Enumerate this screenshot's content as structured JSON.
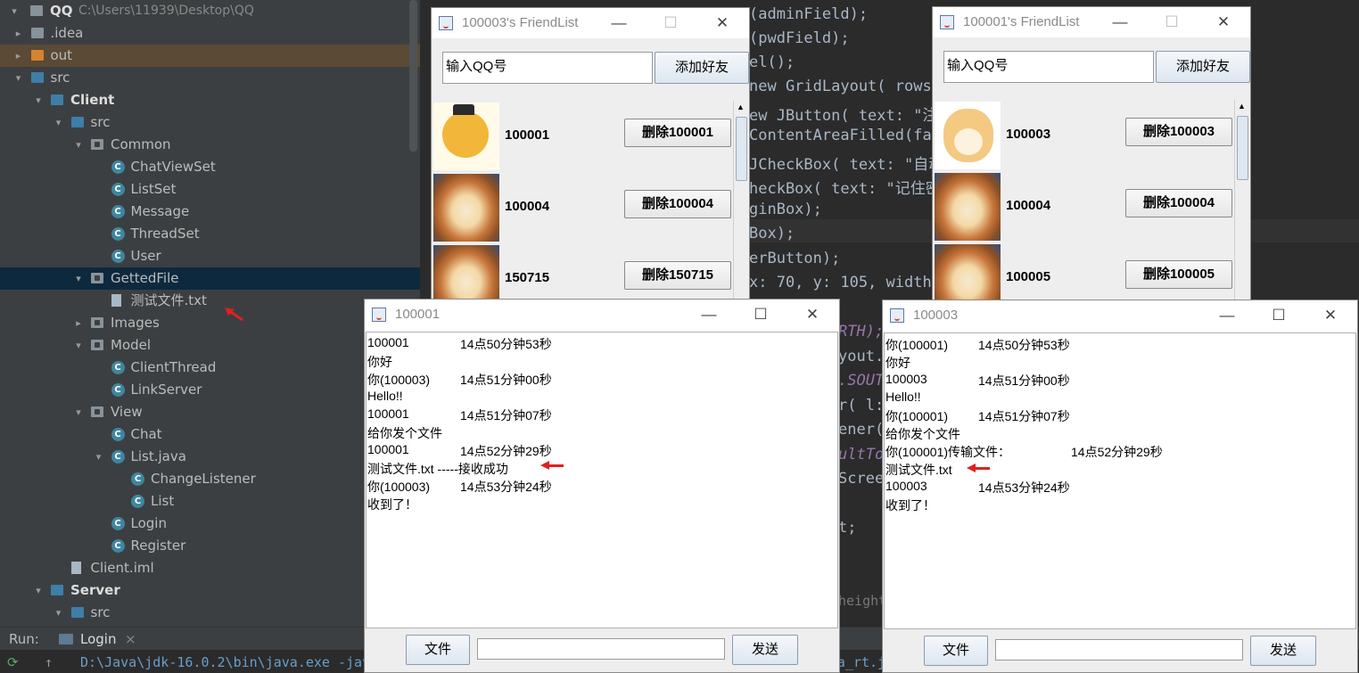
{
  "project_tree": {
    "root": {
      "name": "QQ",
      "path": "C:\\Users\\11939\\Desktop\\QQ"
    },
    "items": [
      {
        "label": ".idea",
        "kind": "folder",
        "depth": 1
      },
      {
        "label": "out",
        "kind": "folder-orange",
        "depth": 1
      },
      {
        "label": "src",
        "kind": "folder-blue",
        "depth": 1
      },
      {
        "label": "Client",
        "kind": "package-bold",
        "depth": 2
      },
      {
        "label": "src",
        "kind": "folder-blue",
        "depth": 3
      },
      {
        "label": "Common",
        "kind": "package",
        "depth": 4
      },
      {
        "label": "ChatViewSet",
        "kind": "class",
        "depth": 5
      },
      {
        "label": "ListSet",
        "kind": "class",
        "depth": 5
      },
      {
        "label": "Message",
        "kind": "class",
        "depth": 5
      },
      {
        "label": "ThreadSet",
        "kind": "class",
        "depth": 5
      },
      {
        "label": "User",
        "kind": "class",
        "depth": 5
      },
      {
        "label": "GettedFile",
        "kind": "package",
        "depth": 4
      },
      {
        "label": "测试文件.txt",
        "kind": "file",
        "depth": 5
      },
      {
        "label": "Images",
        "kind": "package",
        "depth": 4
      },
      {
        "label": "Model",
        "kind": "package",
        "depth": 4
      },
      {
        "label": "ClientThread",
        "kind": "class",
        "depth": 5
      },
      {
        "label": "LinkServer",
        "kind": "class",
        "depth": 5
      },
      {
        "label": "View",
        "kind": "package",
        "depth": 4
      },
      {
        "label": "Chat",
        "kind": "class",
        "depth": 5
      },
      {
        "label": "List.java",
        "kind": "class",
        "depth": 5
      },
      {
        "label": "ChangeListener",
        "kind": "class",
        "depth": 6
      },
      {
        "label": "List",
        "kind": "class",
        "depth": 6
      },
      {
        "label": "Login",
        "kind": "class",
        "depth": 5
      },
      {
        "label": "Register",
        "kind": "class",
        "depth": 5
      },
      {
        "label": "Client.iml",
        "kind": "file",
        "depth": 3
      },
      {
        "label": "Server",
        "kind": "package-bold",
        "depth": 2
      },
      {
        "label": "src",
        "kind": "folder-blue",
        "depth": 3
      }
    ]
  },
  "run_bar": {
    "label": "Run:",
    "tab": "Login",
    "close": "×"
  },
  "console": {
    "line": "D:\\Java\\jdk-16.0.2\\bin\\java.exe  -javaagent:D:\\IntelliJ IDEA Community Edition 2021.2.3\\lib\\idea_rt.jar=31871:D:\\IntelliJ IDEA Community Edition"
  },
  "code": {
    "lines": [
      "(adminField);",
      "(pwdField);",
      "el();",
      "new GridLayout( rows: ",
      "ew JButton( text: \"注册",
      "ContentAreaFilled(fal",
      " JCheckBox( text: \"自动",
      "heckBox( text: \"记住密码",
      "ginBox);",
      "Box);",
      "erButton);",
      " x: 70,  y: 105, width:"
    ],
    "lower_fragments": [
      "RTH);",
      "yout.",
      ".SOUT",
      "r( l: ",
      "ener(",
      "ultTo",
      "Scree",
      "t;",
      "height"
    ]
  },
  "friendlist_windows": [
    {
      "title": "100003's FriendList",
      "input_placeholder": "输入QQ号",
      "add_button": "添加好友",
      "friends": [
        {
          "id": "100001",
          "delete_label": "删除100001",
          "avatar": "cartoon-cat"
        },
        {
          "id": "100004",
          "delete_label": "删除100004",
          "avatar": "shiba-photo"
        },
        {
          "id": "150715",
          "delete_label": "删除150715",
          "avatar": "shiba-photo"
        }
      ]
    },
    {
      "title": "100001's FriendList",
      "input_placeholder": "输入QQ号",
      "add_button": "添加好友",
      "friends": [
        {
          "id": "100003",
          "delete_label": "删除100003",
          "avatar": "cartoon-shiba"
        },
        {
          "id": "100004",
          "delete_label": "删除100004",
          "avatar": "shiba-photo"
        },
        {
          "id": "100005",
          "delete_label": "删除100005",
          "avatar": "shiba-photo"
        }
      ]
    }
  ],
  "chat_windows": [
    {
      "title": "100001",
      "messages": [
        {
          "who": "100001",
          "time": "14点50分钟53秒"
        },
        {
          "text": "你好"
        },
        {
          "who": "你(100003)",
          "time": "14点51分钟00秒"
        },
        {
          "text": "Hello!!"
        },
        {
          "who": "100001",
          "time": "14点51分钟07秒"
        },
        {
          "text": "给你发个文件"
        },
        {
          "who": "100001",
          "time": "14点52分钟29秒"
        },
        {
          "text": "测试文件.txt -----接收成功"
        },
        {
          "who": "你(100003)",
          "time": "14点53分钟24秒"
        },
        {
          "text": "收到了！"
        }
      ],
      "file_button": "文件",
      "send_button": "发送",
      "input_value": ""
    },
    {
      "title": "100003",
      "messages": [
        {
          "who": "你(100001)",
          "time": "14点50分钟53秒"
        },
        {
          "text": "你好"
        },
        {
          "who": "100003",
          "time": "14点51分钟00秒"
        },
        {
          "text": "Hello!!"
        },
        {
          "who": "你(100001)",
          "time": "14点51分钟07秒"
        },
        {
          "text": "给你发个文件"
        },
        {
          "who": "你(100001)传输文件：",
          "time": "14点52分钟29秒"
        },
        {
          "text": "测试文件.txt"
        },
        {
          "who": "100003",
          "time": "14点53分钟24秒"
        },
        {
          "text": "收到了！"
        }
      ],
      "file_button": "文件",
      "send_button": "发送",
      "input_value": ""
    }
  ],
  "colors": {
    "ide_bg": "#2b2b2b",
    "tree_bg": "#3c3f41",
    "selection": "#0d293e",
    "annotation_arrow": "#e02020"
  }
}
